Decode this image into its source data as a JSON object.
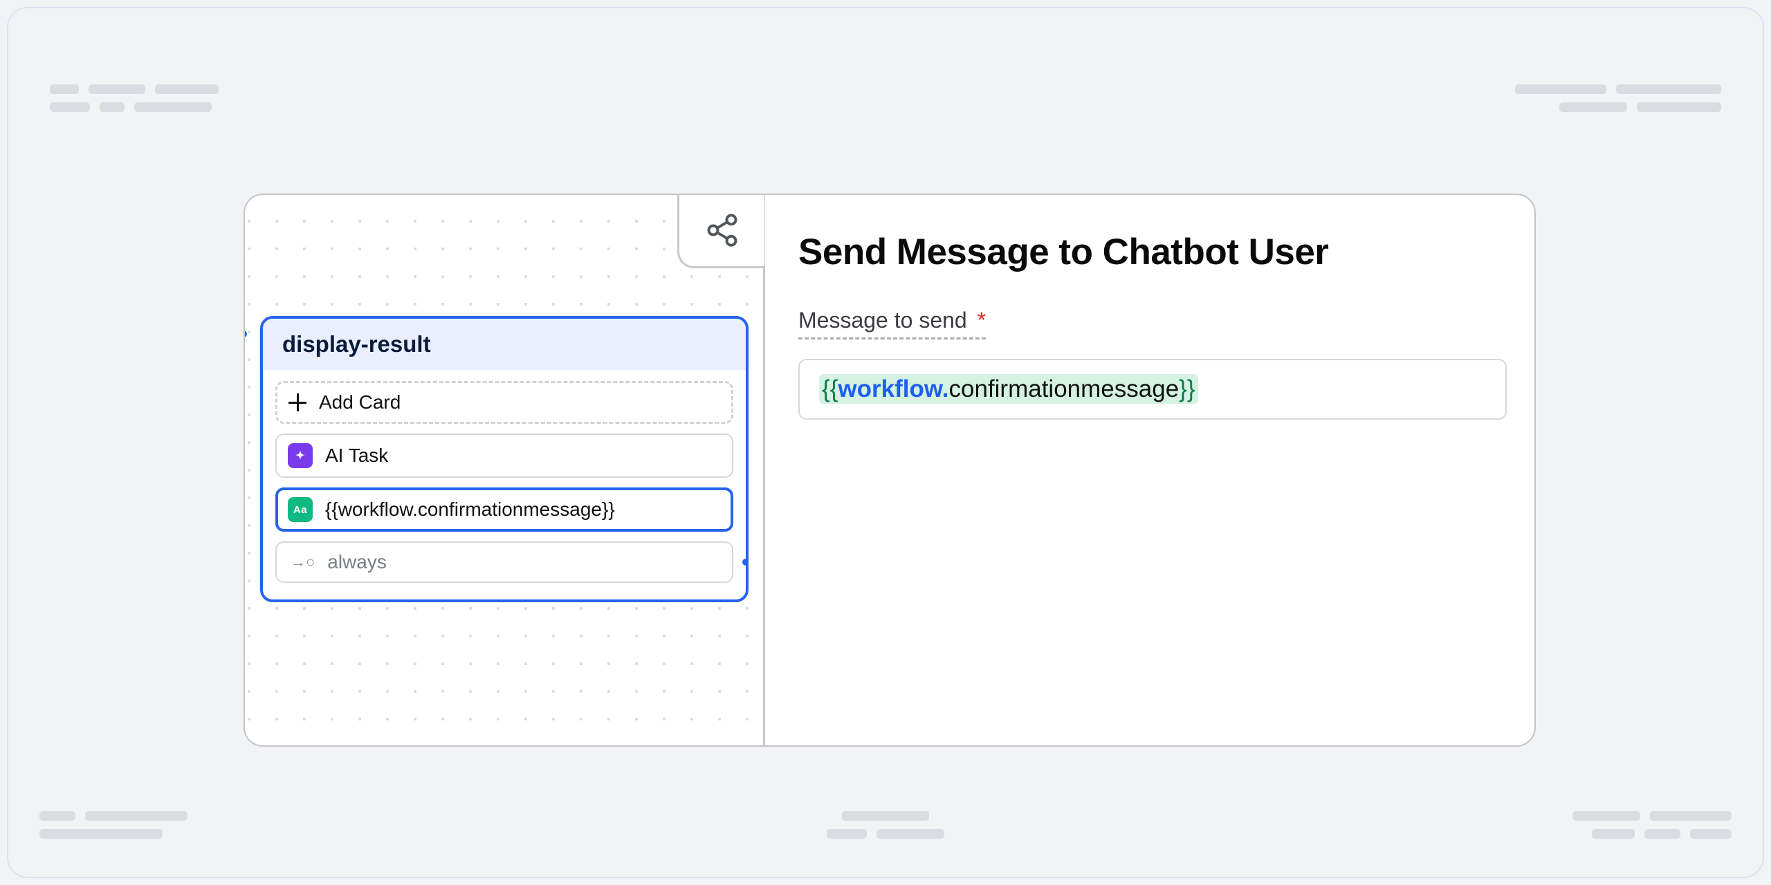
{
  "node": {
    "title": "display-result",
    "add_card_label": "Add Card",
    "cards": [
      {
        "kind": "ai_task",
        "label": "AI Task"
      },
      {
        "kind": "send_message",
        "label": "{{workflow.confirmationmessage}}",
        "selected": true
      }
    ],
    "transition": {
      "label": "always"
    }
  },
  "panel": {
    "title": "Send Message to Chatbot User",
    "field_label": "Message to send",
    "required_mark": "*",
    "value": {
      "open": "{{",
      "namespace": "workflow.",
      "property": "confirmationmessage",
      "close": "}}"
    }
  },
  "icons": {
    "share": "share-nodes-icon",
    "ai_badge": "✦",
    "text_badge": "Aa",
    "transition_arrow": "→○"
  }
}
